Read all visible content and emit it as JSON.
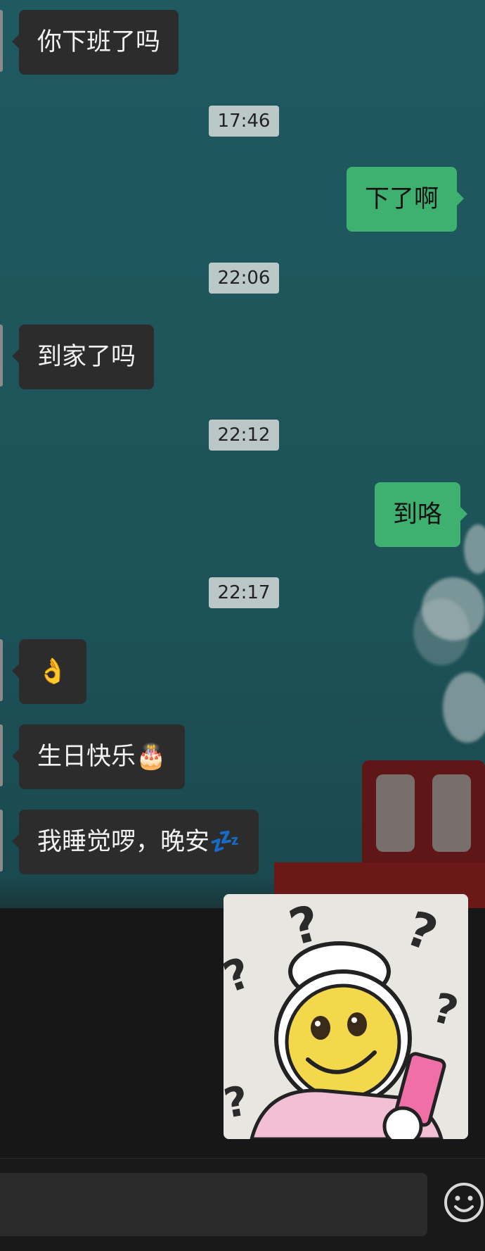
{
  "messages": [
    {
      "side": "in",
      "text": "你下班了吗"
    },
    {
      "time": "17:46"
    },
    {
      "side": "out",
      "text": "下了啊"
    },
    {
      "time": "22:06"
    },
    {
      "side": "in",
      "text": "到家了吗"
    },
    {
      "time": "22:12"
    },
    {
      "side": "out",
      "text": "到咯"
    },
    {
      "time": "22:17"
    },
    {
      "side": "in",
      "text": "👌"
    },
    {
      "side": "in",
      "text": "生日快乐🎂"
    },
    {
      "side": "in",
      "text": "我睡觉啰，晚安💤"
    }
  ],
  "sticker": {
    "icon": "confused-smiley-sticker",
    "marks": "?"
  },
  "input": {
    "placeholder": ""
  },
  "icons": {
    "emoji": "smiley-face-icon"
  },
  "colors": {
    "outgoing": "#3eb070",
    "incoming": "#2c2c2c",
    "time_badge": "#d7dcda"
  }
}
